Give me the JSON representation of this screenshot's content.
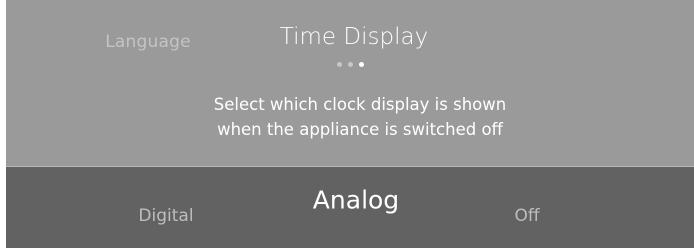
{
  "header": {
    "previous_label": "Language",
    "title": "Time Display",
    "page_indicator": {
      "total": 3,
      "current": 3
    }
  },
  "description": {
    "line1": "Select which clock display is shown",
    "line2": "when the appliance is switched off"
  },
  "options": [
    {
      "label": "Digital"
    },
    {
      "label": "Analog"
    },
    {
      "label": "Off"
    }
  ],
  "selected_option": "Analog",
  "colors": {
    "panel_top": "#9a9a9a",
    "panel_bottom": "#626262",
    "text_primary": "#ffffff",
    "text_secondary": "#c4c4c4"
  }
}
